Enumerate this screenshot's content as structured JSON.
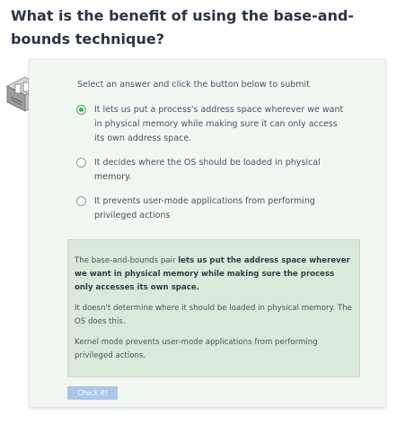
{
  "question": {
    "title": "What is the benefit of using the base-and-bounds technique?"
  },
  "logo": {
    "icon": "isometric-server-icon"
  },
  "quiz": {
    "prompt": "Select an answer and click the button below to submit",
    "options": [
      {
        "label": "It lets us put a process's address space wherever we want in physical memory while making sure it can only access its own address space.",
        "selected": true
      },
      {
        "label": "It decides where the OS should be loaded in physical memory.",
        "selected": false
      },
      {
        "label": "It prevents user-mode applications from performing privileged actions",
        "selected": false
      }
    ],
    "feedback": {
      "p1_prefix": "The base-and-bounds pair ",
      "p1_bold": "lets us put the address space wherever we want in physical memory while making sure the process only accesses its own space.",
      "p2": "It doesn't determine where it should be loaded in physical memory. The OS does this.",
      "p3": "Kernel mode prevents user-mode applications from performing privileged actions."
    },
    "submit_label": "Check It!"
  },
  "colors": {
    "card_bg": "#f2f7f2",
    "feedback_bg": "#dbe9da",
    "selected_accent": "#4caf50",
    "button_bg": "#a9c7e8"
  }
}
